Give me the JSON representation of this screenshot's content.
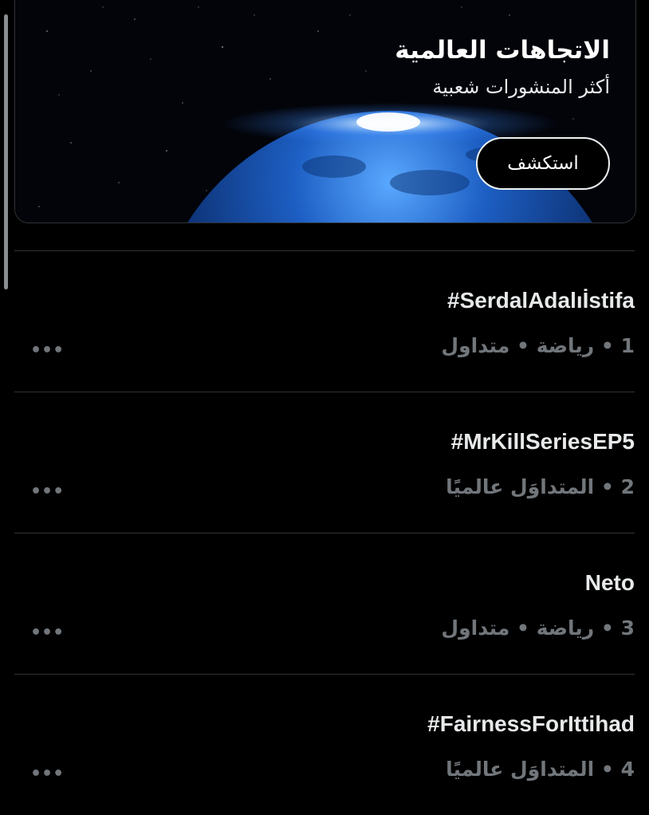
{
  "banner": {
    "title": "الاتجاهات العالمية",
    "subtitle": "أكثر المنشورات شعبية",
    "button_label": "استكشف"
  },
  "trends": [
    {
      "number": "1",
      "category": "1 • رياضة • متداول",
      "name": "#SerdalAdalıİstifa",
      "more": "•••"
    },
    {
      "number": "2",
      "category": "2 • المتداوَل عالميًا",
      "name": "#MrKillSeriesEP5",
      "more": "•••"
    },
    {
      "number": "3",
      "category": "3 • رياضة • متداول",
      "name": "Neto",
      "more": "•••"
    },
    {
      "number": "4",
      "category": "4 • المتداوَل عالميًا",
      "name": "#FairnessForIttihad",
      "more": "•••"
    }
  ],
  "colors": {
    "background": "#000000",
    "primary_text": "#e7e9ea",
    "secondary_text": "#71767b",
    "divider": "#2f3336",
    "earth_glow": "#3d8bff"
  }
}
